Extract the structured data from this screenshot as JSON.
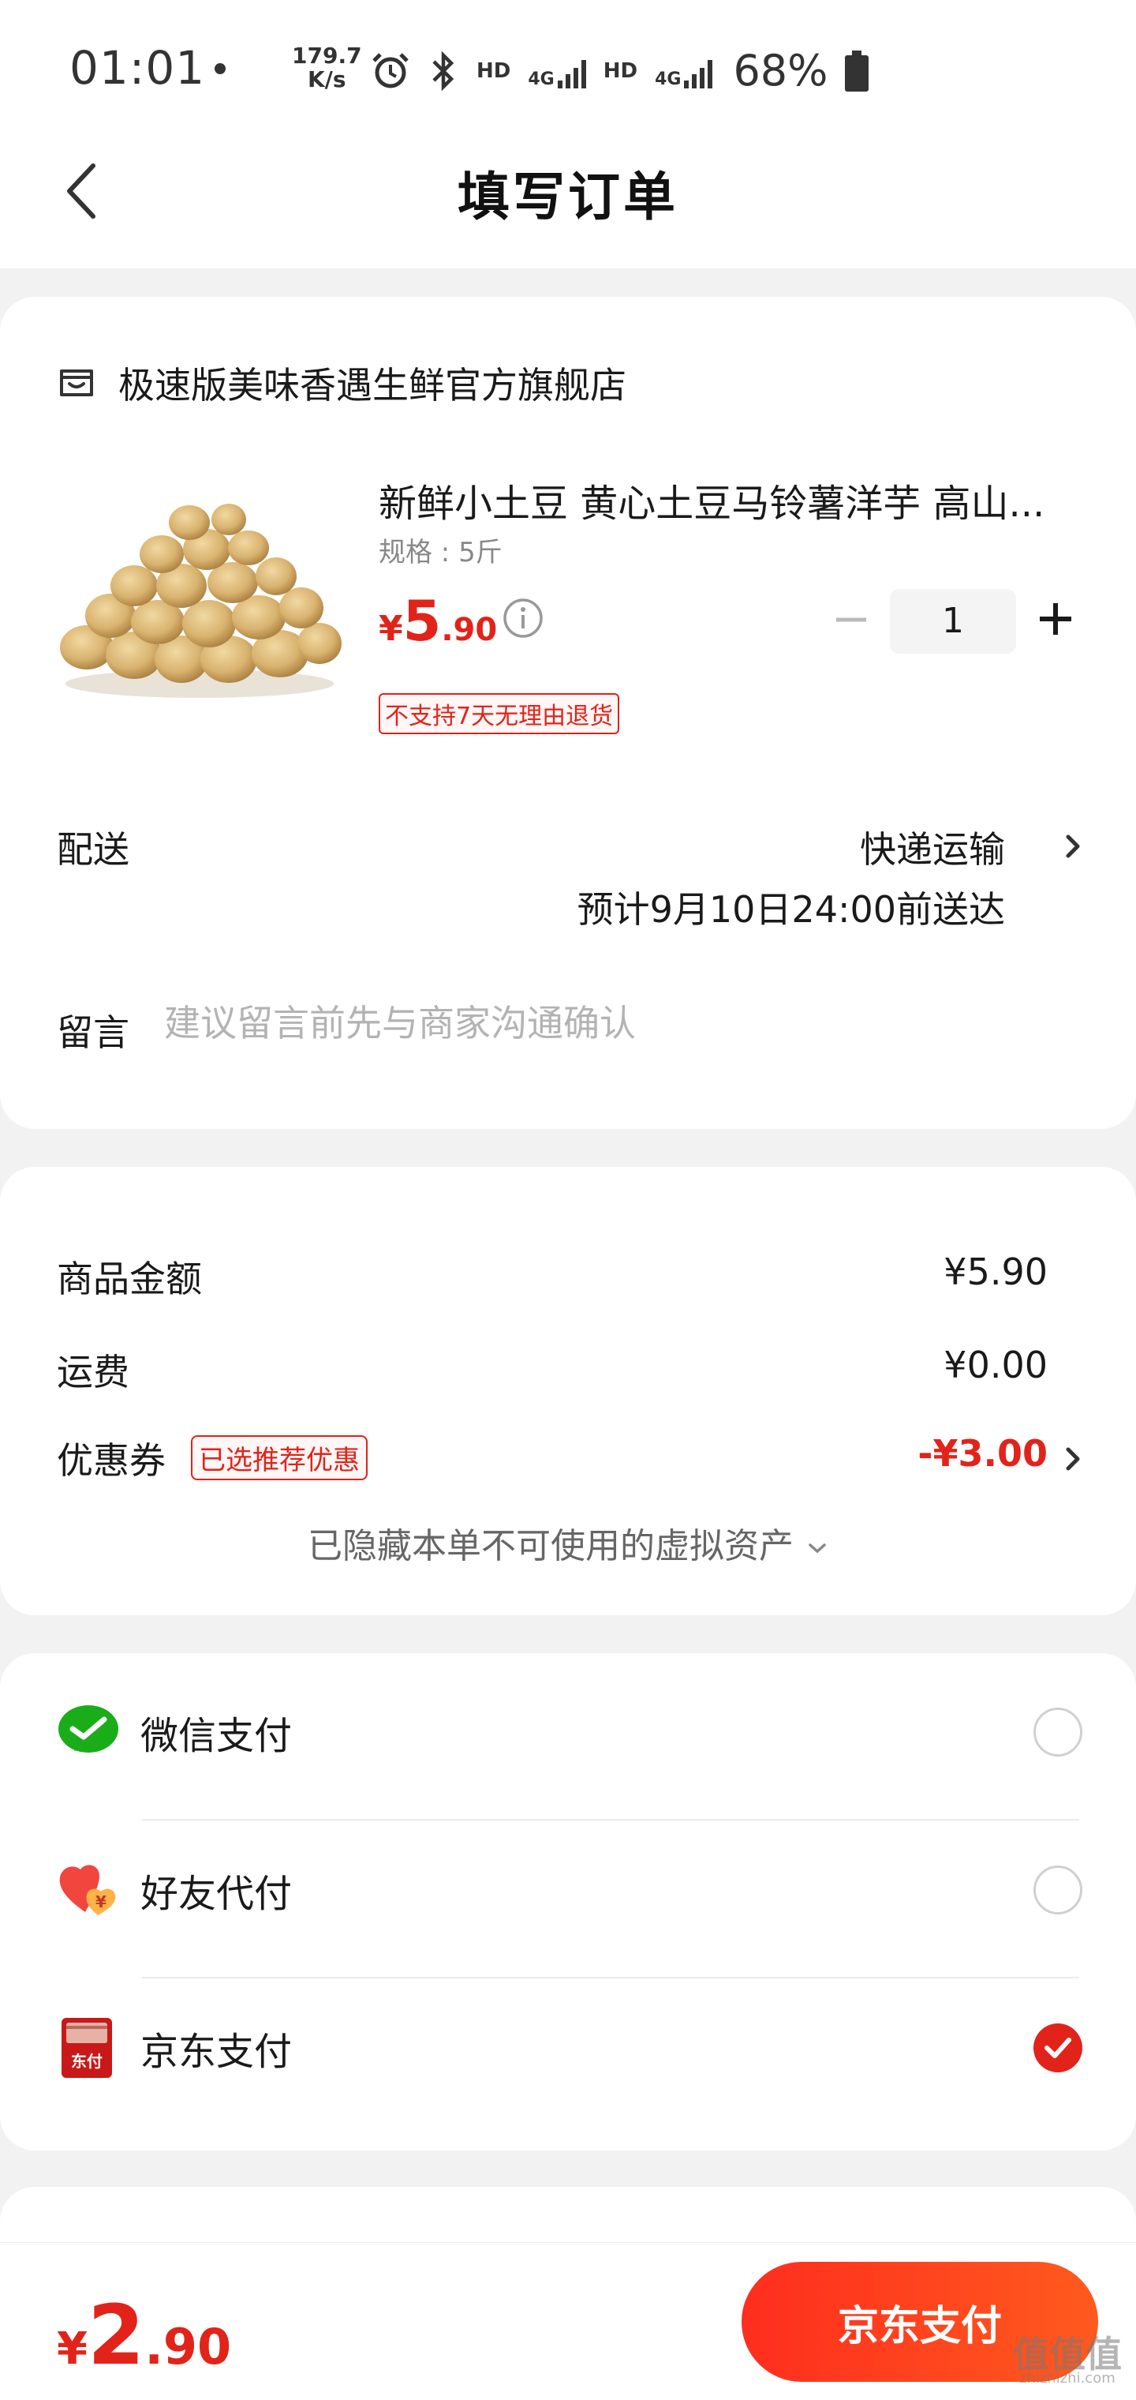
{
  "status_bar": {
    "time": "01:01",
    "net_speed_value": "179.7",
    "net_speed_unit": "K/s",
    "hd1": "HD",
    "hd2": "HD",
    "network1": "4G",
    "network2": "4G",
    "battery": "68%",
    "icons": [
      "dot-icon",
      "alarm-icon",
      "bluetooth-icon",
      "signal-icon",
      "battery-icon"
    ]
  },
  "header": {
    "title": "填写订单",
    "back_icon": "chevron-left-icon"
  },
  "order": {
    "store_icon": "store-icon",
    "store_name": "极速版美味香遇生鲜官方旗舰店",
    "product": {
      "title": "新鲜小土豆 黄心土豆马铃薯洋芋 高山...",
      "spec": "规格 : 5斤",
      "price_currency": "¥",
      "price_int": "5",
      "price_dec": ".90",
      "quantity": "1",
      "return_badge": "不支持7天无理由退货",
      "image": "potato-image"
    },
    "delivery": {
      "label": "配送",
      "method": "快递运输",
      "eta": "预计9月10日24:00前送达"
    },
    "message": {
      "label": "留言",
      "placeholder": "建议留言前先与商家沟通确认",
      "value": ""
    }
  },
  "price_summary": {
    "goods_label": "商品金额",
    "goods_value": "¥5.90",
    "shipping_label": "运费",
    "shipping_value": "¥0.00",
    "coupon_label": "优惠券",
    "coupon_badge": "已选推荐优惠",
    "coupon_value": "-¥3.00",
    "hidden_assets": "已隐藏本单不可使用的虚拟资产"
  },
  "payment_methods": [
    {
      "label": "微信支付",
      "icon": "wechat-pay-icon",
      "selected": false
    },
    {
      "label": "好友代付",
      "icon": "friend-pay-icon",
      "selected": false
    },
    {
      "label": "京东支付",
      "icon": "jd-pay-icon",
      "selected": true
    }
  ],
  "bottom_bar": {
    "total_currency": "¥",
    "total_int": "2",
    "total_dec": ".90",
    "pay_button": "京东支付"
  },
  "watermark": {
    "main": "值值值",
    "sub": "zhizhizhi.com"
  },
  "colors": {
    "accent": "#e2231a",
    "button_gradient_start": "#ff2d1e",
    "button_gradient_end": "#ff5a1e",
    "wechat_green": "#1aad19",
    "background": "#f2f2f2"
  }
}
